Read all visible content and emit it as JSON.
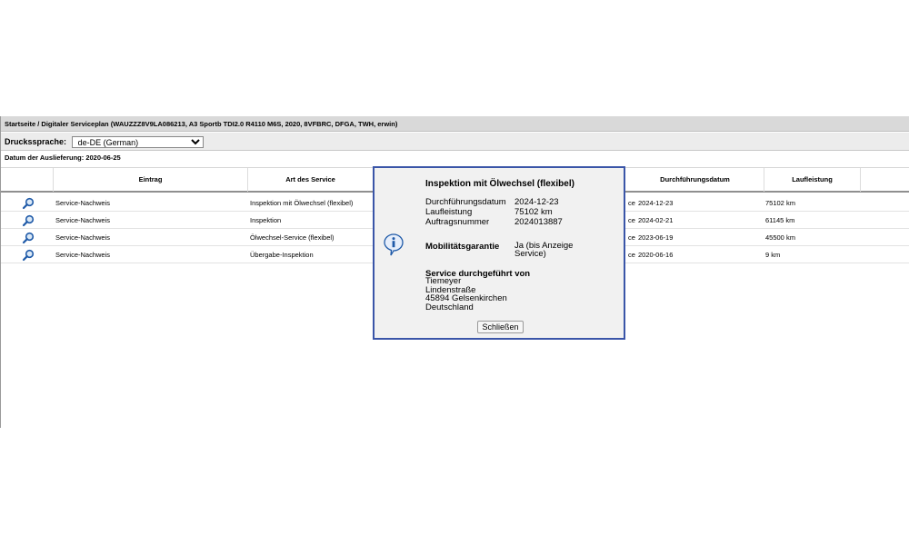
{
  "breadcrumb": "Startseite / Digitaler Serviceplan (WAUZZZ8V9LA086213, A3 Sportb TDI2.0 R4110 M6S, 2020, 8VFBRC, DFGA, TWH, erwin)",
  "print_language": {
    "label": "Druckssprache:",
    "selected": "de-DE (German)"
  },
  "issue_date": "Datum der Auslieferung: 2020-06-25",
  "table": {
    "headers": [
      "Eintrag",
      "Art des Service",
      "Durchführungsdatum",
      "Laufleistung"
    ],
    "rows": [
      {
        "entry": "Service-Nachweis",
        "type": "Inspektion mit Ölwechsel (flexibel)",
        "type_tail": "ce",
        "date": "2024-12-23",
        "mileage": "75102 km"
      },
      {
        "entry": "Service-Nachweis",
        "type": "Inspektion",
        "type_tail": "ce",
        "date": "2024-02-21",
        "mileage": "61145 km"
      },
      {
        "entry": "Service-Nachweis",
        "type": "Ölwechsel-Service (flexibel)",
        "type_tail": "ce",
        "date": "2023-06-19",
        "mileage": "45500 km"
      },
      {
        "entry": "Service-Nachweis",
        "type": "Übergabe-Inspektion",
        "type_tail": "ce",
        "date": "2020-06-16",
        "mileage": "9 km"
      }
    ]
  },
  "dialog": {
    "title": "Inspektion mit Ölwechsel (flexibel)",
    "date_label": "Durchführungsdatum",
    "date_value": "2024-12-23",
    "mileage_label": "Laufleistung",
    "mileage_value": "75102 km",
    "order_label": "Auftragsnummer",
    "order_value": "2024013887",
    "mobility_label": "Mobilitätsgarantie",
    "mobility_value": "Ja (bis Anzeige Service)",
    "service_by_label": "Service durchgeführt von",
    "address": [
      "Tiemeyer",
      "Lindenstraße",
      "45894 Gelsenkirchen",
      "Deutschland"
    ],
    "close_label": "Schließen"
  },
  "icons": {
    "view": "magnifier-icon",
    "info": "info-icon"
  },
  "colors": {
    "dialog_border": "#3a55a8",
    "icon_blue": "#1f5aa8"
  }
}
